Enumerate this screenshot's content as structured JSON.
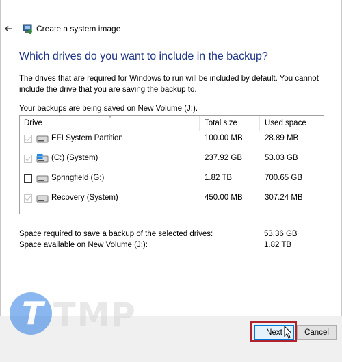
{
  "window": {
    "title": "Create a system image"
  },
  "main": {
    "heading": "Which drives do you want to include in the backup?",
    "description": "The drives that are required for Windows to run will be included by default. You cannot include the drive that you are saving the backup to.",
    "saving_note": "Your backups are being saved on New Volume (J:)."
  },
  "table": {
    "columns": [
      "Drive",
      "Total size",
      "Used space"
    ],
    "rows": [
      {
        "name": "EFI System Partition",
        "total": "100.00 MB",
        "used": "28.89 MB",
        "state": "checked-disabled",
        "icon": "drive-icon"
      },
      {
        "name": "(C:) (System)",
        "total": "237.92 GB",
        "used": "53.03 GB",
        "state": "checked-disabled",
        "icon": "windows-drive-icon"
      },
      {
        "name": "Springfield (G:)",
        "total": "1.82 TB",
        "used": "700.65 GB",
        "state": "unchecked",
        "icon": "drive-icon"
      },
      {
        "name": "Recovery (System)",
        "total": "450.00 MB",
        "used": "307.24 MB",
        "state": "checked-disabled",
        "icon": "drive-icon"
      }
    ]
  },
  "space": {
    "required_label": "Space required to save a backup of the selected drives:",
    "required_value": "53.36 GB",
    "available_label": "Space available on New Volume (J:):",
    "available_value": "1.82 TB"
  },
  "footer": {
    "next_label": "Next",
    "cancel_label": "Cancel"
  },
  "watermark": {
    "letter": "T",
    "text": "TMP"
  },
  "colors": {
    "heading": "#1e3287",
    "highlight": "#b2222c",
    "watermark_circle": "#2b7de3"
  }
}
